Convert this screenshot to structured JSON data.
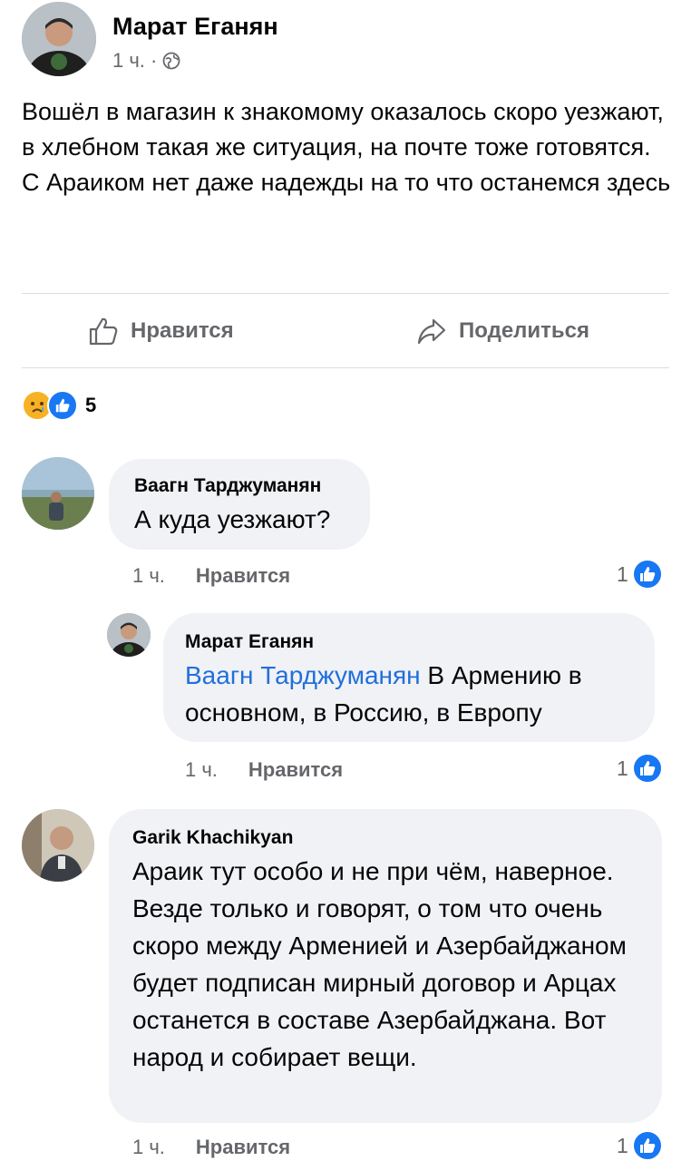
{
  "post": {
    "author": "Марат Еганян",
    "time": "1 ч. ·",
    "audience_icon": "globe-icon",
    "text_lines": [
      "Вошёл в магазин к знакомому оказалось  скоро уезжают, в хлебном такая же ситуация, на почте тоже готовятся.",
      "С Араиком нет даже надежды на то что останемся здесь"
    ]
  },
  "actions": {
    "like_label": "Нравится",
    "share_label": "Поделиться"
  },
  "reactions": {
    "icons": [
      "sad-reaction-icon",
      "like-reaction-icon"
    ],
    "count": "5"
  },
  "comments": [
    {
      "author": "Ваагн Тарджуманян",
      "text": "А куда уезжают?",
      "time": "1 ч.",
      "like_label": "Нравится",
      "likes": "1"
    },
    {
      "author": "Марат Еганян",
      "mention": "Ваагн Тарджуманян",
      "text": " В Армению в основном, в Россию, в Европу",
      "time": "1 ч.",
      "like_label": "Нравится",
      "likes": "1"
    },
    {
      "author": "Garik Khachikyan",
      "text": "Араик тут особо и не при чём, наверное. Везде только и говорят, о том что очень скоро между Арменией и Азербайджаном будет подписан мирный договор и Арцах останется в составе Азербайджана. Вот народ и собирает вещи.",
      "time": "1 ч.",
      "like_label": "Нравится",
      "likes": "1"
    }
  ],
  "colors": {
    "link": "#216fdb",
    "like_blue": "#1877f2",
    "bubble": "#f0f2f5",
    "meta_gray": "#65676b"
  }
}
